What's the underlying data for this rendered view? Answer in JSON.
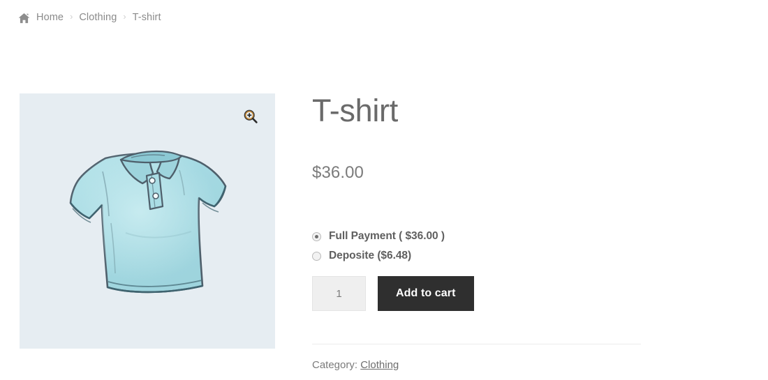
{
  "breadcrumb": {
    "home_icon": "home-icon",
    "separator": "›",
    "items": [
      {
        "label": "Home"
      },
      {
        "label": "Clothing"
      },
      {
        "label": "T-shirt"
      }
    ]
  },
  "gallery": {
    "zoom_icon": "magnifier-plus-icon",
    "image_alt": "T-shirt",
    "background_color": "#e6edf2",
    "shirt_fill": "#a8dce4",
    "shirt_outline": "#4a5a66"
  },
  "product": {
    "title": "T-shirt",
    "price": "$36.00"
  },
  "payment_plans": {
    "options": [
      {
        "label": "Full Payment ( $36.00 )",
        "checked": true
      },
      {
        "label": "Deposite ($6.48)",
        "checked": false
      }
    ]
  },
  "cart": {
    "quantity_value": "1",
    "quantity_placeholder": "1",
    "add_to_cart_label": "Add to cart",
    "button_color": "#2f2f2f"
  },
  "meta": {
    "category_label": "Category:",
    "category_value": "Clothing"
  }
}
